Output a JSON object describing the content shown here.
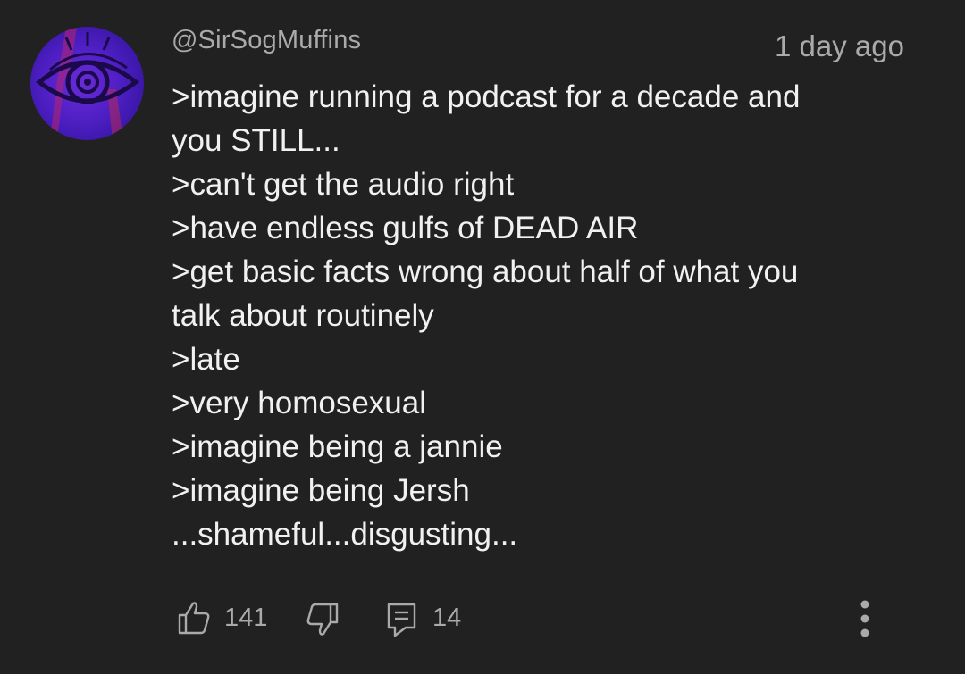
{
  "comment": {
    "username": "@SirSogMuffins",
    "timestamp": "1 day ago",
    "lines": [
      ">imagine running a podcast for a decade and",
      "you STILL...",
      ">can't get the audio right",
      ">have endless gulfs of DEAD AIR",
      ">get basic facts wrong about half of what you",
      "talk about routinely",
      ">late",
      ">very homosexual",
      ">imagine being a jannie",
      ">imagine being Jersh",
      "...shameful...disgusting..."
    ],
    "actions": {
      "like_count": "141",
      "reply_count": "14",
      "like_icon": "thumbs-up-icon",
      "dislike_icon": "thumbs-down-icon",
      "reply_icon": "comment-icon",
      "more_icon": "more-vertical-icon"
    }
  },
  "colors": {
    "background": "#212121",
    "primary_text": "#f1f1f1",
    "secondary_text": "#aaaaaa",
    "avatar_purple": "#5a23cf"
  }
}
